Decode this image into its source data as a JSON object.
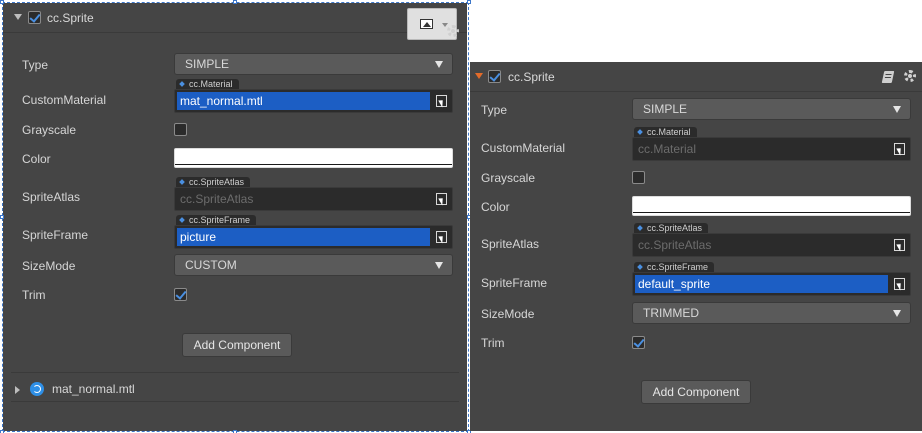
{
  "left_inspector": {
    "component_title": "cc.Sprite",
    "enabled": true,
    "props": {
      "type": {
        "label": "Type",
        "value": "SIMPLE"
      },
      "custom_material": {
        "label": "CustomMaterial",
        "tag": "cc.Material",
        "value": "mat_normal.mtl"
      },
      "grayscale": {
        "label": "Grayscale",
        "checked": false
      },
      "color": {
        "label": "Color",
        "value": "#ffffff"
      },
      "sprite_atlas": {
        "label": "SpriteAtlas",
        "tag": "cc.SpriteAtlas",
        "value": "cc.SpriteAtlas"
      },
      "sprite_frame": {
        "label": "SpriteFrame",
        "tag": "cc.SpriteFrame",
        "value": "picture"
      },
      "size_mode": {
        "label": "SizeMode",
        "value": "CUSTOM"
      },
      "trim": {
        "label": "Trim",
        "checked": true
      }
    },
    "add_component": "Add Component",
    "material_entry": "mat_normal.mtl",
    "header_icons": [
      "image-icon",
      "gear-icon"
    ]
  },
  "right_inspector": {
    "component_title": "cc.Sprite",
    "enabled": true,
    "props": {
      "type": {
        "label": "Type",
        "value": "SIMPLE"
      },
      "custom_material": {
        "label": "CustomMaterial",
        "tag": "cc.Material",
        "value": "cc.Material"
      },
      "grayscale": {
        "label": "Grayscale",
        "checked": false
      },
      "color": {
        "label": "Color",
        "value": "#ffffff"
      },
      "sprite_atlas": {
        "label": "SpriteAtlas",
        "tag": "cc.SpriteAtlas",
        "value": "cc.SpriteAtlas"
      },
      "sprite_frame": {
        "label": "SpriteFrame",
        "tag": "cc.SpriteFrame",
        "value": "default_sprite"
      },
      "size_mode": {
        "label": "SizeMode",
        "value": "TRIMMED"
      },
      "trim": {
        "label": "Trim",
        "checked": true
      }
    },
    "add_component": "Add Component",
    "header_icons": [
      "book-icon",
      "gear-icon"
    ]
  },
  "colors": {
    "panel_bg": "#454545",
    "field_bg": "#2b2b2b",
    "selection_blue": "#1c5ec4",
    "accent_orange": "#e36b2a"
  }
}
